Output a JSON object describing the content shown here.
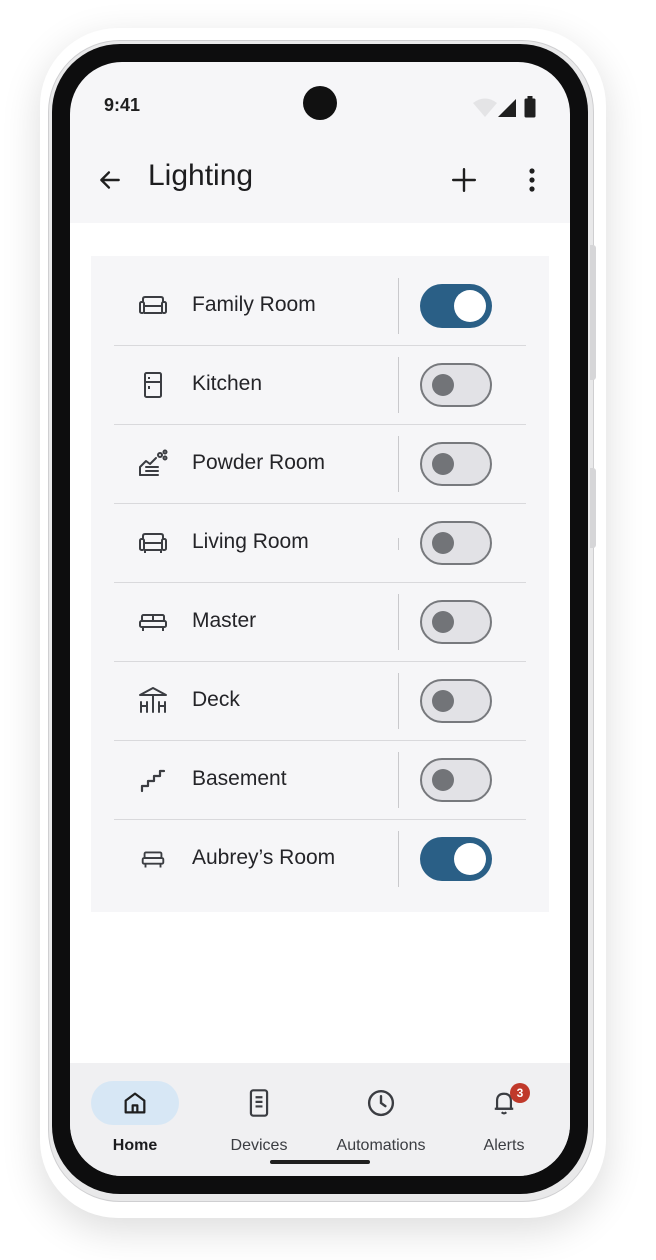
{
  "status_bar": {
    "time": "9:41"
  },
  "app_bar": {
    "title": "Lighting"
  },
  "rooms": [
    {
      "name": "Family Room",
      "icon": "armchair-icon",
      "on": true
    },
    {
      "name": "Kitchen",
      "icon": "fridge-icon",
      "on": false
    },
    {
      "name": "Powder Room",
      "icon": "wash-hands-icon",
      "on": false
    },
    {
      "name": "Living Room",
      "icon": "armchair-icon",
      "on": false
    },
    {
      "name": "Master",
      "icon": "bed-icon",
      "on": false
    },
    {
      "name": "Deck",
      "icon": "deck-icon",
      "on": false
    },
    {
      "name": "Basement",
      "icon": "stairs-icon",
      "on": false
    },
    {
      "name": "Aubrey’s Room",
      "icon": "bed-icon",
      "on": true
    }
  ],
  "nav": {
    "items": [
      {
        "label": "Home",
        "icon": "home-icon",
        "active": true
      },
      {
        "label": "Devices",
        "icon": "devices-icon",
        "active": false
      },
      {
        "label": "Automations",
        "icon": "clock-icon",
        "active": false
      },
      {
        "label": "Alerts",
        "icon": "bell-icon",
        "active": false,
        "badge": "3"
      }
    ]
  },
  "colors": {
    "toggle_on": "#2a5f86",
    "active_nav": "#d7e7f5",
    "badge": "#c0392b"
  }
}
